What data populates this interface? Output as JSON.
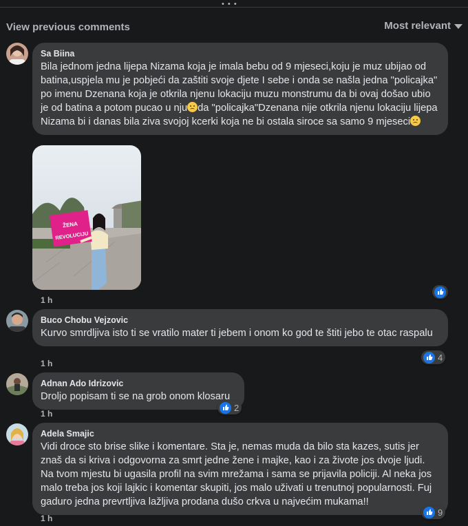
{
  "header": {
    "view_previous": "View previous comments",
    "sort_label": "Most relevant",
    "top_dots": "• • •"
  },
  "comments": [
    {
      "author": "Sa Biina",
      "text_parts": [
        "Bila jednom jedna lijepa Nizama koja je imala bebu od 9 mjeseci,koju je muz ubijao od batina,uspjela mu je pobjeći da zaštiti svoje djete I sebe i onda se našla jedna \"policajka\" po imenu Dzenana koja je otkrila njenu lokaciju muzu monstrumu da bi ovaj došao ubio je od batina a potom pucao u nju",
        "da \"policajka\"Dzenana nije otkrila njenu lokaciju lijepa Nizama bi i danas bila ziva svojoj kcerki koja ne bi ostala siroce sa samo 9 mjeseci"
      ],
      "emoji": "sad-face-emoji",
      "photo_sign": {
        "line1": "ŽENA",
        "line2": "REVOLUCIJU"
      },
      "time": "1 h",
      "reactions": ""
    },
    {
      "author": "Buco Chobu Vejzovic",
      "text": "Kurvo smrdljiva isto ti se vratilo mater ti jebem i onom ko god te štiti jebo te otac raspalu",
      "time": "1 h",
      "reactions": "4"
    },
    {
      "author": "Adnan Ado Idrizovic",
      "text": "Droljo popisam ti se na grob onom klosaru",
      "time": "1 h",
      "reactions": "2"
    },
    {
      "author": "Adela Smajic",
      "text": "Vidi droce sto brise slike i komentare. Sta je, nemas muda da bilo sta kazes, sutis jer znaš da si kriva i odgovorna za smrt jedne žene i majke, kao i za živote jos dvoje ljudi. Na tvom mjestu bi ugasila profil na svim mrežama i sama se prijavila policiji. Al neka jos malo treba jos koji lajkic i komentar skupiti, jos malo uživati u trenutnoj popularnosti. Fuj gaduro jedna prevrtljiva lažljiva prodana dušo crkva u najvećim mukama!!",
      "time": "1 h",
      "reactions": "9"
    }
  ],
  "colors": {
    "background": "#18191a",
    "bubble": "#3a3b3c",
    "text": "#e4e6eb",
    "muted": "#b0b3b8",
    "like_blue": "#1b74e4",
    "sign_pink": "#e0218a"
  }
}
